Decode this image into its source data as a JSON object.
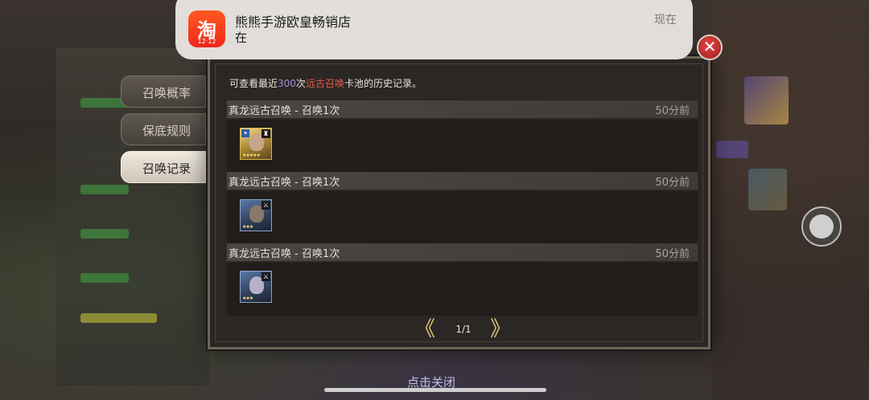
{
  "notification": {
    "app_icon_glyph": "淘",
    "app_icon_sub": "12·12",
    "title": "熊熊手游欧皇畅销店",
    "body": "在",
    "time": "现在"
  },
  "tabs": [
    {
      "label": "召唤概率"
    },
    {
      "label": "保底规则"
    },
    {
      "label": "召唤记录"
    }
  ],
  "dialog": {
    "info_prefix": "可查看最近",
    "info_count": "300",
    "info_mid": "次",
    "info_pool": "远古召唤",
    "info_suffix": "卡池的历史记录。"
  },
  "records": [
    {
      "title": "真龙远古召唤 - 召唤1次",
      "time": "50分前",
      "hero_stars": "★★★★★",
      "hero_class": "♜"
    },
    {
      "title": "真龙远古召唤 - 召唤1次",
      "time": "50分前",
      "hero_stars": "★★★",
      "hero_class": "⚔"
    },
    {
      "title": "真龙远古召唤 - 召唤1次",
      "time": "50分前",
      "hero_stars": "★★★",
      "hero_class": "⚔"
    }
  ],
  "pager": {
    "page": "1/1",
    "prev": "《",
    "next": "》"
  },
  "close_hint": "点击关闭",
  "close_button": "✕",
  "colors": {
    "accent_purple": "#a98de0",
    "accent_red": "#e85a4a",
    "gold": "#e2c07a"
  }
}
